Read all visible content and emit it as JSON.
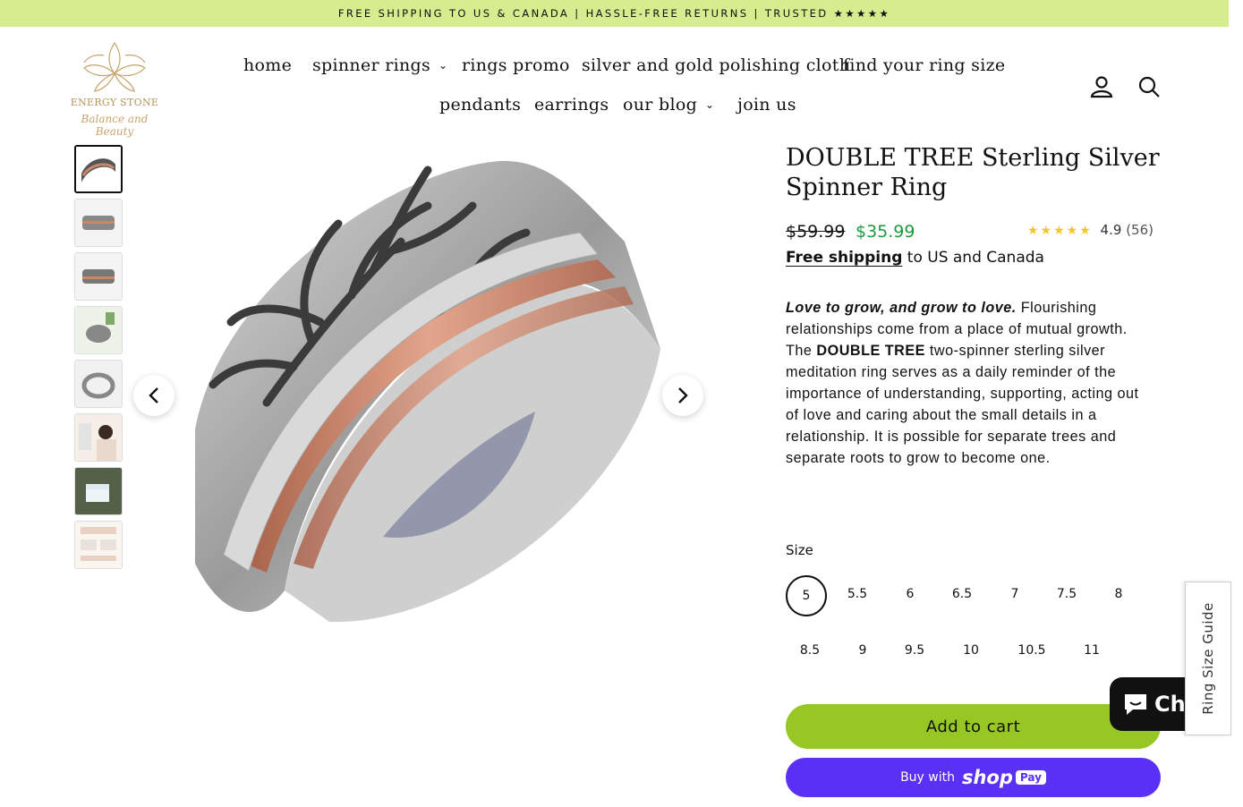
{
  "announcement": "FREE SHIPPING TO US & CANADA | HASSLE-FREE RETURNS | TRUSTED ★★★★★",
  "logo": {
    "brand": "ENERGY STONE",
    "tagline": "Balance and Beauty"
  },
  "nav": {
    "row1": [
      {
        "label": "home"
      },
      {
        "label": "spinner rings",
        "dropdown": true
      },
      {
        "label": "rings promo"
      },
      {
        "label": "silver and gold polishing cloth"
      },
      {
        "label": "find your ring size"
      }
    ],
    "row2": [
      {
        "label": "pendants"
      },
      {
        "label": "earrings"
      },
      {
        "label": "our blog",
        "dropdown": true
      },
      {
        "label": "join us"
      }
    ]
  },
  "header_icons": [
    "account-icon",
    "search-icon"
  ],
  "gallery": {
    "thumbnail_count": 8,
    "active_index": 0
  },
  "product": {
    "title": "DOUBLE TREE Sterling Silver Spinner Ring",
    "price_old": "$59.99",
    "price_new": "$35.99",
    "rating_stars": "★★★★★",
    "rating_value": "4.9",
    "rating_count": "(56)",
    "shipping_link": "Free shipping",
    "shipping_rest": " to US and Canada",
    "desc_lead": "Love to grow, and grow to love.",
    "desc_1": " Flourishing relationships come from a place of mutual growth. The ",
    "desc_bold": "DOUBLE TREE",
    "desc_2": " two-spinner sterling silver meditation ring serves as a daily reminder of the importance of understanding, supporting, acting out of love and caring about the small details in a relationship.  It is possible for separate trees and separate roots to grow to become one.",
    "size_label": "Size",
    "sizes": [
      "5",
      "5.5",
      "6",
      "6.5",
      "7",
      "7.5",
      "8",
      "8.5",
      "9",
      "9.5",
      "10",
      "10.5",
      "11"
    ],
    "selected_size": "5",
    "add_to_cart": "Add to cart",
    "buy_with": "Buy with",
    "shop_pay_shop": "shop",
    "shop_pay_pay": "Pay"
  },
  "chat_label": "Ch",
  "size_guide": "Ring Size Guide",
  "colors": {
    "announce_bg": "#d6ec8e",
    "cart_btn": "#96c725",
    "shop_pay": "#5a31f4",
    "sale_price": "#1a9c3c"
  }
}
